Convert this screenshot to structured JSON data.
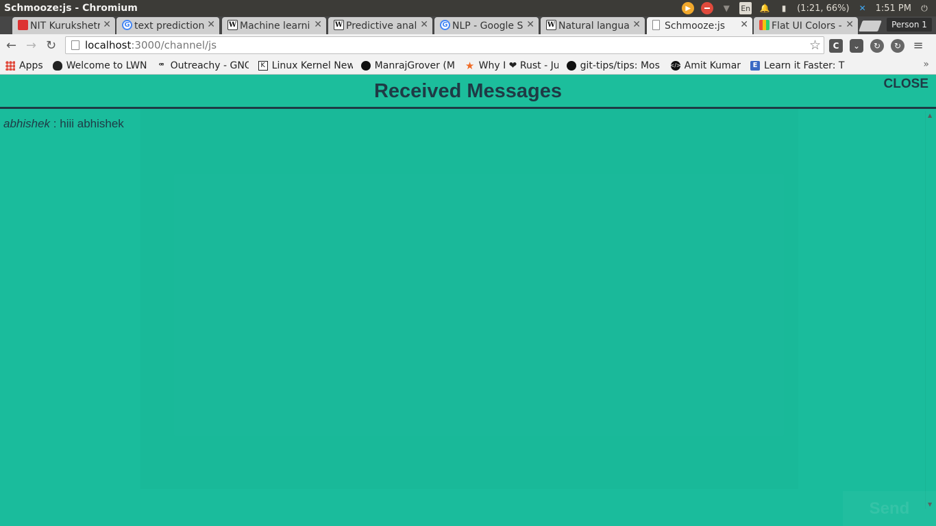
{
  "os": {
    "window_title": "Schmooze:js - Chromium",
    "battery": "(1:21, 66%)",
    "clock": "1:51 PM",
    "lang": "En"
  },
  "tabs": [
    {
      "label": "NIT Kurukshetr",
      "icon": "nit-logo-icon"
    },
    {
      "label": "text prediction",
      "icon": "google-icon"
    },
    {
      "label": "Machine learni",
      "icon": "wikipedia-icon"
    },
    {
      "label": "Predictive anal",
      "icon": "wikipedia-icon"
    },
    {
      "label": "NLP - Google Sc",
      "icon": "google-icon"
    },
    {
      "label": "Natural langua",
      "icon": "wikipedia-icon"
    },
    {
      "label": "Schmooze:js",
      "icon": "page-icon",
      "active": true
    },
    {
      "label": "Flat UI Colors -",
      "icon": "flat-ui-icon"
    }
  ],
  "profile": "Person 1",
  "address": {
    "host": "localhost",
    "rest": ":3000/channel/js"
  },
  "bookmarks": [
    {
      "label": "Apps",
      "icon": "apps-icon"
    },
    {
      "label": "Welcome to LWN",
      "icon": "tux-icon"
    },
    {
      "label": "Outreachy - GNO",
      "icon": "gnome-icon"
    },
    {
      "label": "Linux Kernel New",
      "icon": "kernel-icon"
    },
    {
      "label": "ManrajGrover (M",
      "icon": "github-icon"
    },
    {
      "label": "Why I ❤ Rust - Jul",
      "icon": "star-icon"
    },
    {
      "label": "git-tips/tips: Mos",
      "icon": "github-icon"
    },
    {
      "label": "Amit Kumar",
      "icon": "code-icon"
    },
    {
      "label": "Learn it Faster: Th",
      "icon": "learn-icon"
    }
  ],
  "modal": {
    "title": "Received Messages",
    "close_label": "CLOSE",
    "messages": [
      {
        "user": "abhishek",
        "separator": " : ",
        "text": "hiii abhishek"
      }
    ]
  },
  "ghost_send_label": "Send",
  "colors": {
    "background": "#1abc9c",
    "text": "#1f3a45"
  }
}
